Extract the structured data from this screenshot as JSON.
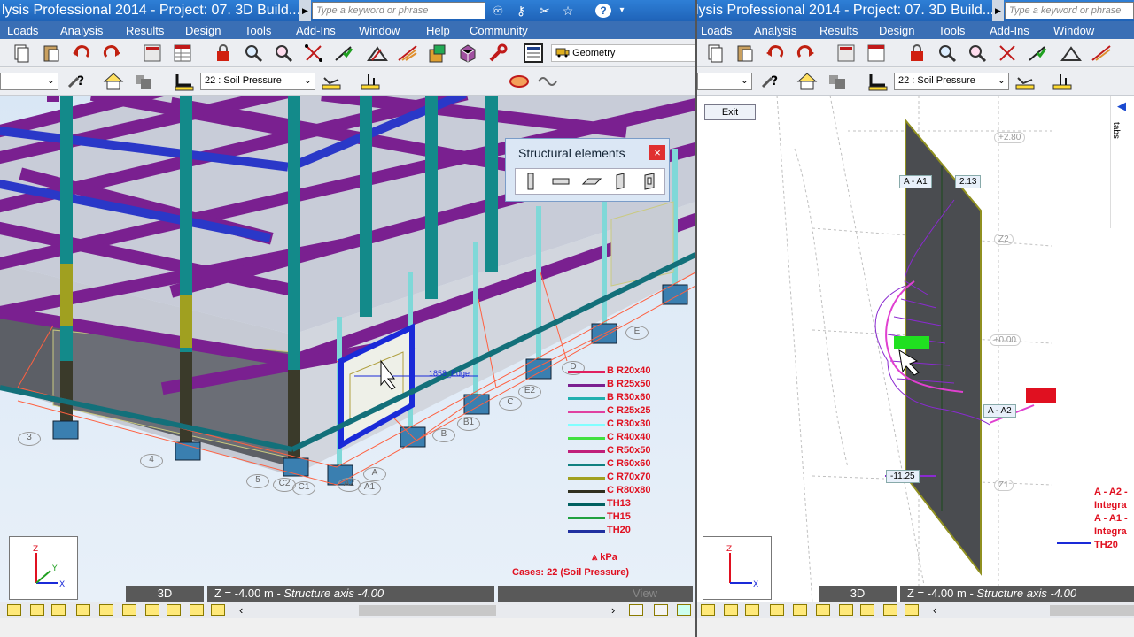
{
  "window_title": "lysis Professional 2014 - Project: 07. 3D Build...",
  "search_placeholder": "Type a keyword or phrase",
  "menu_left": [
    "Loads",
    "Analysis",
    "Results",
    "Design",
    "Tools",
    "Add-Ins",
    "Window",
    "Help",
    "Community"
  ],
  "menu_right": [
    "Loads",
    "Analysis",
    "Results",
    "Design",
    "Tools",
    "Add-Ins",
    "Window"
  ],
  "geometry_label": "Geometry",
  "case_combo": "22 : Soil Pressure",
  "structural_panel": {
    "title": "Structural elements",
    "close": "×"
  },
  "left_view": {
    "edge_label": "1858_Edge",
    "axis_bubbles": [
      "3",
      "4",
      "5",
      "E",
      "E2",
      "D",
      "C",
      "B",
      "A",
      "A1",
      "C2",
      "B1",
      "A2",
      "C1"
    ],
    "legend": [
      {
        "label": "B R20x40",
        "color": "#e02060"
      },
      {
        "label": "B R25x50",
        "color": "#7a2090"
      },
      {
        "label": "B R30x60",
        "color": "#20b0b0"
      },
      {
        "label": "C R25x25",
        "color": "#e040a0"
      },
      {
        "label": "C R30x30",
        "color": "#80ffff"
      },
      {
        "label": "C R40x40",
        "color": "#40e040"
      },
      {
        "label": "C R50x50",
        "color": "#c0207a"
      },
      {
        "label": "C R60x60",
        "color": "#108080"
      },
      {
        "label": "C R70x70",
        "color": "#a0a020"
      },
      {
        "label": "C R80x80",
        "color": "#303020"
      },
      {
        "label": "TH13",
        "color": "#006060"
      },
      {
        "label": "TH15",
        "color": "#20a040"
      },
      {
        "label": "TH20",
        "color": "#2030a0"
      }
    ],
    "units": "kPa",
    "cases": "Cases: 22 (Soil Pressure)",
    "status_mode": "3D",
    "status_z": "Z = -4.00 m - ",
    "status_axis": "Structure axis -4.00",
    "status_view": "View"
  },
  "right_view": {
    "exit": "Exit",
    "tabs": "tabs",
    "labels": [
      "A - A1",
      "2.13",
      "A - A2",
      "-11.25"
    ],
    "grid_labels": [
      "+2.80",
      "Z2",
      "±0.00",
      "Z1"
    ],
    "legend": [
      "A - A2 -",
      "Integra",
      "A - A1 -",
      "Integra",
      "TH20"
    ],
    "status_mode": "3D",
    "status_z": "Z = -4.00 m - ",
    "status_axis": "Structure axis -4.00"
  },
  "colors": {
    "title_blue": "#1f63b8",
    "menu_blue": "#3a6fb5",
    "beam_purple": "#7a2090",
    "column_teal": "#138a8a",
    "selection_blue": "#1a2ad8"
  }
}
